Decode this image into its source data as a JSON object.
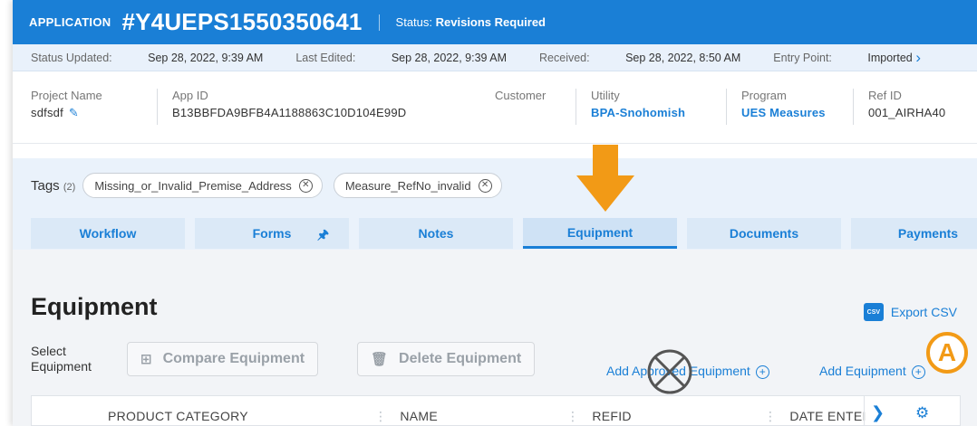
{
  "header": {
    "app_label": "APPLICATION",
    "app_id": "#Y4UEPS1550350641",
    "status_label": "Status:",
    "status_value": "Revisions Required"
  },
  "subheader": {
    "status_updated_label": "Status Updated:",
    "status_updated_value": "Sep 28, 2022, 9:39 AM",
    "last_edited_label": "Last Edited:",
    "last_edited_value": "Sep 28, 2022, 9:39 AM",
    "received_label": "Received:",
    "received_value": "Sep 28, 2022, 8:50 AM",
    "entry_point_label": "Entry Point:",
    "entry_point_value": "Imported"
  },
  "info": {
    "project_name_label": "Project Name",
    "project_name_value": "sdfsdf",
    "app_id_label": "App ID",
    "app_id_value": "B13BBFDA9BFB4A1188863C10D104E99D",
    "customer_label": "Customer",
    "utility_label": "Utility",
    "utility_value": "BPA-Snohomish",
    "program_label": "Program",
    "program_value": "UES Measures",
    "ref_id_label": "Ref ID",
    "ref_id_value": "001_AIRHA40"
  },
  "tags": {
    "label": "Tags",
    "count": "(2)",
    "items": [
      "Missing_or_Invalid_Premise_Address",
      "Measure_RefNo_invalid"
    ]
  },
  "tabs": [
    "Workflow",
    "Forms",
    "Notes",
    "Equipment",
    "Documents",
    "Payments"
  ],
  "equipment": {
    "title": "Equipment",
    "export_label": "Export CSV",
    "export_icon_text": "CSV",
    "select_label_1": "Select",
    "select_label_2": "Equipment",
    "compare_label": "Compare Equipment",
    "delete_label": "Delete Equipment",
    "add_approved_label": "Add Approved Equipment",
    "add_label": "Add Equipment",
    "columns": [
      "PRODUCT CATEGORY",
      "NAME",
      "REFID",
      "DATE ENTEI"
    ]
  },
  "annotation": {
    "badge": "A",
    "colors": {
      "accent": "#f29a16",
      "primary": "#1a7fd6"
    }
  }
}
